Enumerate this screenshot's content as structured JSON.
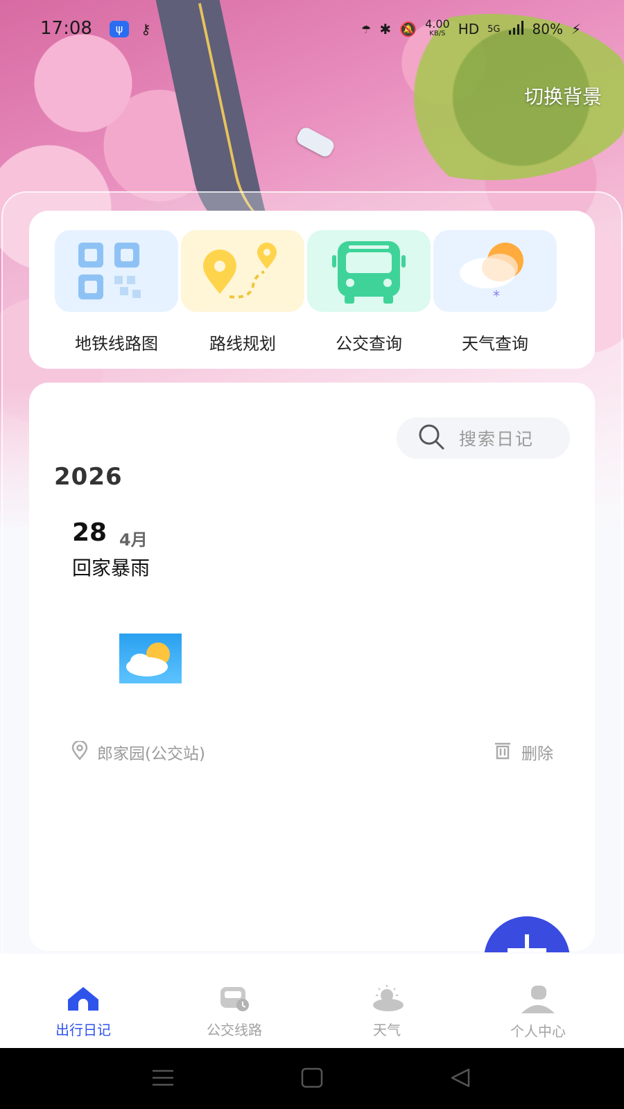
{
  "status_bar": {
    "time": "17:08",
    "usb": "ψ",
    "net_speed_value": "4.00",
    "net_speed_unit": "KB/S",
    "hd": "HD",
    "signal": "5G",
    "battery": "80%"
  },
  "header": {
    "switch_background": "切换背景"
  },
  "quick_menu": [
    {
      "label": "地铁线路图",
      "icon": "qr-code-icon",
      "tile_color": "#e6f2ff"
    },
    {
      "label": "路线规划",
      "icon": "route-pin-icon",
      "tile_color": "#fff6d8"
    },
    {
      "label": "公交查询",
      "icon": "bus-icon",
      "tile_color": "#dcfaef"
    },
    {
      "label": "天气查询",
      "icon": "weather-snow-icon",
      "tile_color": "#e9f3ff"
    }
  ],
  "diary": {
    "search_placeholder": "搜索日记",
    "year": "2026",
    "entry": {
      "day": "28",
      "month": "4月",
      "title": "回家暴雨",
      "location": "郎家园(公交站)",
      "delete_label": "删除"
    }
  },
  "bottom_nav": [
    {
      "label": "出行日记",
      "icon": "home-icon",
      "active": true
    },
    {
      "label": "公交线路",
      "icon": "bus-route-icon",
      "active": false
    },
    {
      "label": "天气",
      "icon": "weather-icon",
      "active": false
    },
    {
      "label": "个人中心",
      "icon": "user-icon",
      "active": false
    }
  ],
  "colors": {
    "accent": "#2f54eb",
    "fab": "#3a4be0"
  }
}
